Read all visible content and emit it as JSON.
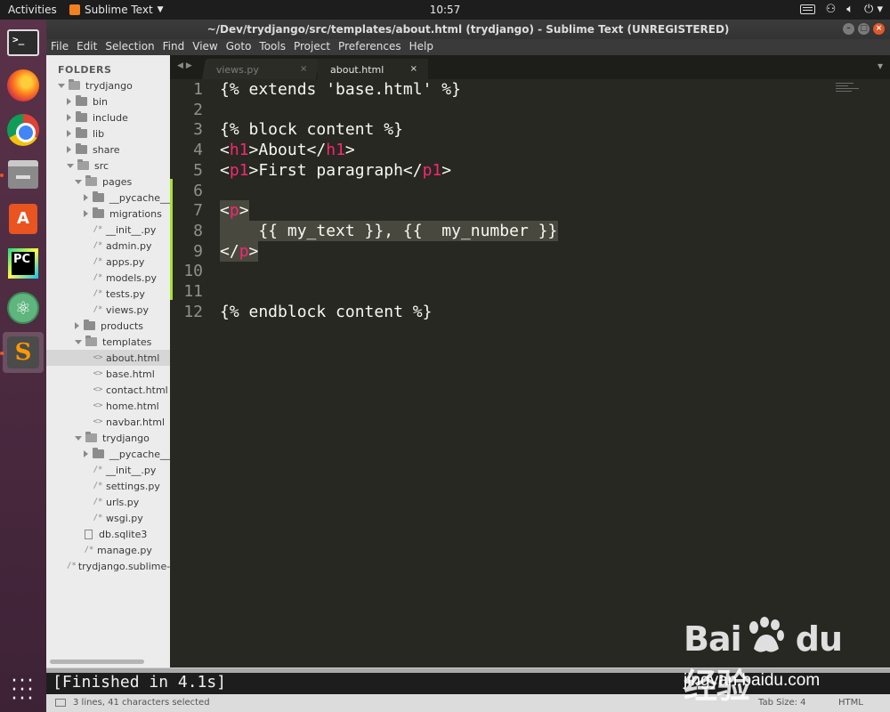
{
  "topbar": {
    "activities": "Activities",
    "app_name": "Sublime Text",
    "clock": "10:57"
  },
  "window": {
    "title": "~/Dev/trydjango/src/templates/about.html (trydjango) - Sublime Text (UNREGISTERED)"
  },
  "menu": [
    "File",
    "Edit",
    "Selection",
    "Find",
    "View",
    "Goto",
    "Tools",
    "Project",
    "Preferences",
    "Help"
  ],
  "sidebar": {
    "header": "FOLDERS",
    "items": [
      {
        "label": "trydjango",
        "type": "folder-open",
        "depth": 0
      },
      {
        "label": "bin",
        "type": "folder",
        "depth": 1
      },
      {
        "label": "include",
        "type": "folder",
        "depth": 1
      },
      {
        "label": "lib",
        "type": "folder",
        "depth": 1
      },
      {
        "label": "share",
        "type": "folder",
        "depth": 1
      },
      {
        "label": "src",
        "type": "folder-open",
        "depth": 1
      },
      {
        "label": "pages",
        "type": "folder-open",
        "depth": 2
      },
      {
        "label": "__pycache__",
        "type": "folder",
        "depth": 3
      },
      {
        "label": "migrations",
        "type": "folder",
        "depth": 3
      },
      {
        "label": "__init__.py",
        "type": "py",
        "depth": 3
      },
      {
        "label": "admin.py",
        "type": "py",
        "depth": 3
      },
      {
        "label": "apps.py",
        "type": "py",
        "depth": 3
      },
      {
        "label": "models.py",
        "type": "py",
        "depth": 3
      },
      {
        "label": "tests.py",
        "type": "py",
        "depth": 3
      },
      {
        "label": "views.py",
        "type": "py",
        "depth": 3
      },
      {
        "label": "products",
        "type": "folder",
        "depth": 2
      },
      {
        "label": "templates",
        "type": "folder-open",
        "depth": 2
      },
      {
        "label": "about.html",
        "type": "html",
        "depth": 3,
        "selected": true
      },
      {
        "label": "base.html",
        "type": "html",
        "depth": 3
      },
      {
        "label": "contact.html",
        "type": "html",
        "depth": 3
      },
      {
        "label": "home.html",
        "type": "html",
        "depth": 3
      },
      {
        "label": "navbar.html",
        "type": "html",
        "depth": 3
      },
      {
        "label": "trydjango",
        "type": "folder-open",
        "depth": 2
      },
      {
        "label": "__pycache__",
        "type": "folder",
        "depth": 3
      },
      {
        "label": "__init__.py",
        "type": "py",
        "depth": 3
      },
      {
        "label": "settings.py",
        "type": "py",
        "depth": 3
      },
      {
        "label": "urls.py",
        "type": "py",
        "depth": 3
      },
      {
        "label": "wsgi.py",
        "type": "py",
        "depth": 3
      },
      {
        "label": "db.sqlite3",
        "type": "db",
        "depth": 2
      },
      {
        "label": "manage.py",
        "type": "py",
        "depth": 2
      },
      {
        "label": "trydjango.sublime-",
        "type": "py",
        "depth": 1
      }
    ]
  },
  "tabs": [
    {
      "label": "views.py",
      "active": false
    },
    {
      "label": "about.html",
      "active": true
    }
  ],
  "editor": {
    "lines": [
      {
        "n": "1",
        "text": "{% extends 'base.html' %}"
      },
      {
        "n": "2",
        "text": ""
      },
      {
        "n": "3",
        "text": "{% block content %}"
      },
      {
        "n": "4",
        "text": "<h1>About</h1>"
      },
      {
        "n": "5",
        "text": "<p1>First paragraph</p1>"
      },
      {
        "n": "6",
        "text": ""
      },
      {
        "n": "7",
        "text": "<p>"
      },
      {
        "n": "8",
        "text": "    {{ my_text }}, {{  my_number }}"
      },
      {
        "n": "9",
        "text": "</p>"
      },
      {
        "n": "10",
        "text": ""
      },
      {
        "n": "11",
        "text": ""
      },
      {
        "n": "12",
        "text": "{% endblock content %}"
      }
    ],
    "selected_lines": [
      7,
      8,
      9
    ]
  },
  "output": {
    "text": "[Finished in 4.1s]"
  },
  "statusbar": {
    "message": "3 lines, 41 characters selected",
    "tab_size": "Tab Size: 4",
    "syntax": "HTML"
  },
  "watermark": {
    "logo": "Bai du 经验",
    "url": "jingyan.baidu.com"
  },
  "colors": {
    "accent": "#e95420",
    "editor_bg": "#272822",
    "tag": "#f92672",
    "gutter_mark": "#a6e22e"
  }
}
